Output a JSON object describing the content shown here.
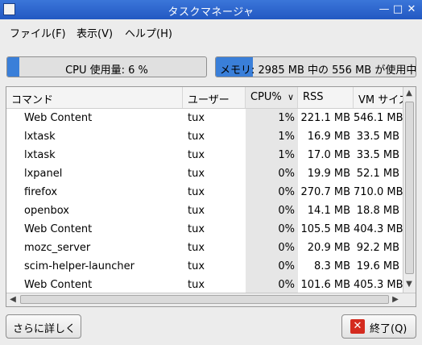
{
  "window": {
    "title": "タスクマネージャ",
    "icon": "task-manager-app-icon"
  },
  "menubar": {
    "items": [
      "ファイル(F)",
      "表示(V)",
      "ヘルプ(H)"
    ]
  },
  "cpu_meter": {
    "label": "CPU 使用量: 6 %",
    "percent": 6
  },
  "mem_meter": {
    "label": "メモリ: 2985 MB 中の 556 MB が使用中",
    "used_mb": 556,
    "total_mb": 2985,
    "color": "#3a7fd9"
  },
  "table": {
    "columns": {
      "command": "コマンド",
      "user": "ユーザー",
      "cpu": "CPU%",
      "rss": "RSS",
      "vm": "VM サイズ"
    },
    "sorted_column": "cpu",
    "rows": [
      {
        "command": "Web Content",
        "user": "tux",
        "cpu": "1%",
        "rss": "221.1 MB",
        "vm": "546.1 MB"
      },
      {
        "command": "lxtask",
        "user": "tux",
        "cpu": "1%",
        "rss": "16.9 MB",
        "vm": "33.5 MB"
      },
      {
        "command": "lxtask",
        "user": "tux",
        "cpu": "1%",
        "rss": "17.0 MB",
        "vm": "33.5 MB"
      },
      {
        "command": "lxpanel",
        "user": "tux",
        "cpu": "0%",
        "rss": "19.9 MB",
        "vm": "52.1 MB"
      },
      {
        "command": "firefox",
        "user": "tux",
        "cpu": "0%",
        "rss": "270.7 MB",
        "vm": "710.0 MB"
      },
      {
        "command": "openbox",
        "user": "tux",
        "cpu": "0%",
        "rss": "14.1 MB",
        "vm": "18.8 MB"
      },
      {
        "command": "Web Content",
        "user": "tux",
        "cpu": "0%",
        "rss": "105.5 MB",
        "vm": "404.3 MB"
      },
      {
        "command": "mozc_server",
        "user": "tux",
        "cpu": "0%",
        "rss": "20.9 MB",
        "vm": "92.2 MB"
      },
      {
        "command": "scim-helper-launcher",
        "user": "tux",
        "cpu": "0%",
        "rss": "8.3 MB",
        "vm": "19.6 MB"
      },
      {
        "command": "Web Content",
        "user": "tux",
        "cpu": "0%",
        "rss": "101.6 MB",
        "vm": "405.3 MB"
      }
    ]
  },
  "buttons": {
    "more": "さらに詳しく",
    "quit": "終了(Q)"
  }
}
